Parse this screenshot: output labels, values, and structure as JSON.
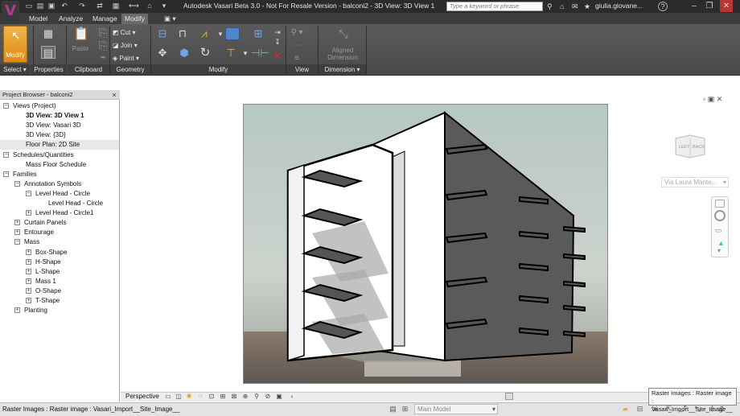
{
  "title_bar": {
    "title": "Autodesk Vasari Beta 3.0 - Not For Resale Version -     balconi2 - 3D View: 3D View 1",
    "search_placeholder": "Type a keyword or phrase",
    "user": "giulia.giovane...",
    "help": "?"
  },
  "tabs": [
    "Model",
    "Analyze",
    "Manage",
    "Modify"
  ],
  "active_tab": "Modify",
  "ribbon": {
    "modify_label": "Modify",
    "paste_label": "Paste",
    "cut_label": "Cut",
    "join_label": "Join",
    "paint_label": "Paint",
    "aligned_dimension_label": "Aligned\nDimension",
    "panels": [
      "Select",
      "Properties",
      "Clipboard",
      "Geometry",
      "Modify",
      "View",
      "Dimension"
    ]
  },
  "project_browser": {
    "title": "Project Browser - balconi2",
    "close": "×",
    "tree": [
      {
        "label": "Views (Project)",
        "level": 0,
        "expander": "−"
      },
      {
        "label": "3D View: 3D View 1",
        "level": 1,
        "bold": true
      },
      {
        "label": "3D View: Vasari 3D",
        "level": 1
      },
      {
        "label": "3D View: {3D}",
        "level": 1
      },
      {
        "label": "Floor Plan: 2D Site",
        "level": 1,
        "selected": true
      },
      {
        "label": "Schedules/Quantities",
        "level": 0,
        "expander": "−"
      },
      {
        "label": "Mass Floor Schedule",
        "level": 1
      },
      {
        "label": "Families",
        "level": 0,
        "expander": "−"
      },
      {
        "label": "Annotation Symbols",
        "level": 1,
        "expander": "−"
      },
      {
        "label": "Level Head - Circle",
        "level": 2,
        "expander": "−"
      },
      {
        "label": "Level Head - Circle",
        "level": 3
      },
      {
        "label": "Level Head - Circle1",
        "level": 2,
        "expander": "+"
      },
      {
        "label": "Curtain Panels",
        "level": 1,
        "expander": "+"
      },
      {
        "label": "Entourage",
        "level": 1,
        "expander": "+"
      },
      {
        "label": "Mass",
        "level": 1,
        "expander": "−"
      },
      {
        "label": "Box-Shape",
        "level": 2,
        "expander": "+"
      },
      {
        "label": "H-Shape",
        "level": 2,
        "expander": "+"
      },
      {
        "label": "L-Shape",
        "level": 2,
        "expander": "+"
      },
      {
        "label": "Mass 1",
        "level": 2,
        "expander": "+"
      },
      {
        "label": "O-Shape",
        "level": 2,
        "expander": "+"
      },
      {
        "label": "T-Shape",
        "level": 2,
        "expander": "+"
      },
      {
        "label": "Planting",
        "level": 1,
        "expander": "+"
      }
    ]
  },
  "view": {
    "nav_combo": "Via Laura Mante...",
    "viewcube_left": "LEFT",
    "viewcube_back": "BACK"
  },
  "view_control_bar": {
    "label": "Perspective"
  },
  "status_bar": {
    "text": "Raster Images : Raster image : Vasari_Import__Site_Image__",
    "model": "Main Model",
    "count": ":0"
  },
  "tooltip": {
    "line1": "Raster Images : Raster image :",
    "line2": "Vasari_Import__Site_Image__"
  },
  "colors": {
    "accent": "#de8a17",
    "ribbon": "#4f4f4f",
    "title_bar": "#2b2b2b"
  }
}
